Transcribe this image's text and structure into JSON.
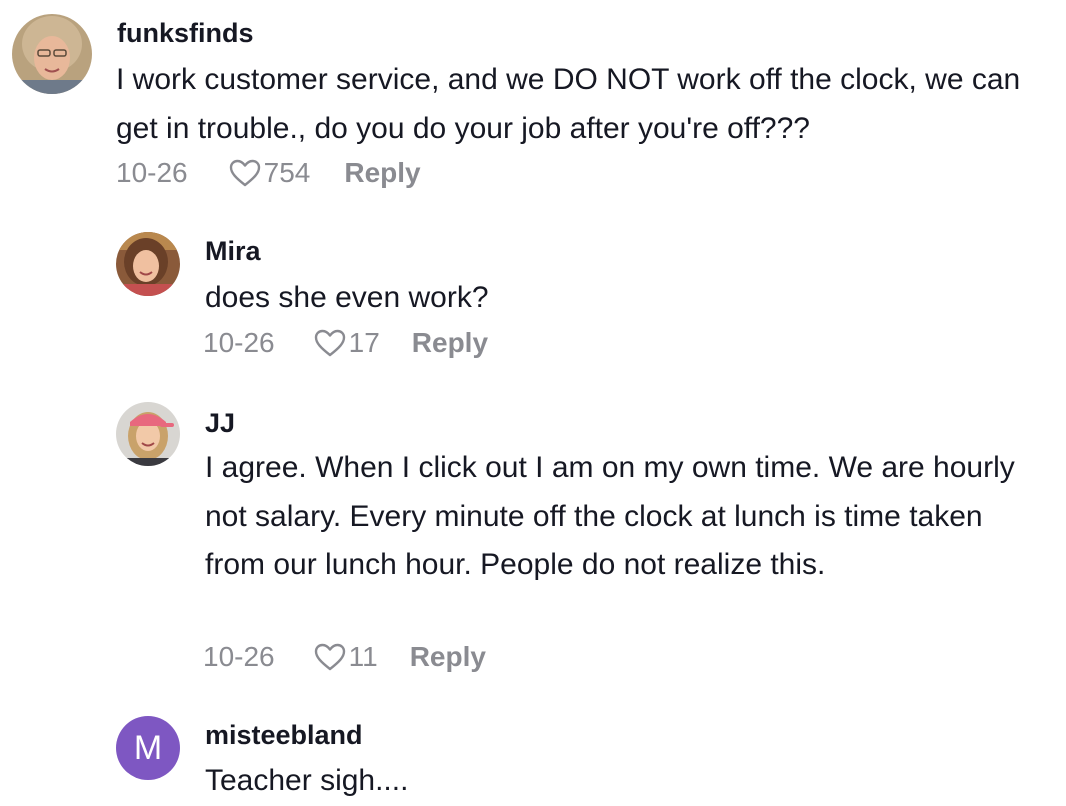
{
  "comments": [
    {
      "username": "funksfinds",
      "text": "I work customer service, and we DO NOT work off the clock, we can get in trouble., do you do your job after you're off???",
      "date": "10-26",
      "likes": "754",
      "reply_label": "Reply"
    },
    {
      "username": "Mira",
      "text": "does she even work?",
      "date": "10-26",
      "likes": "17",
      "reply_label": "Reply"
    },
    {
      "username": "JJ",
      "text": "I agree. When I click out I am on my own time. We are hourly not salary. Every minute off the clock at lunch is time taken from our lunch hour. People do not realize this.",
      "date": "10-26",
      "likes": "11",
      "reply_label": "Reply"
    },
    {
      "username": "misteebland",
      "avatar_letter": "M",
      "text": "Teacher sigh...."
    }
  ],
  "colors": {
    "text": "#161823",
    "muted": "#8a8b91",
    "letter_avatar_bg": "#7e57c2"
  },
  "icons": {
    "like": "heart-outline-icon"
  }
}
